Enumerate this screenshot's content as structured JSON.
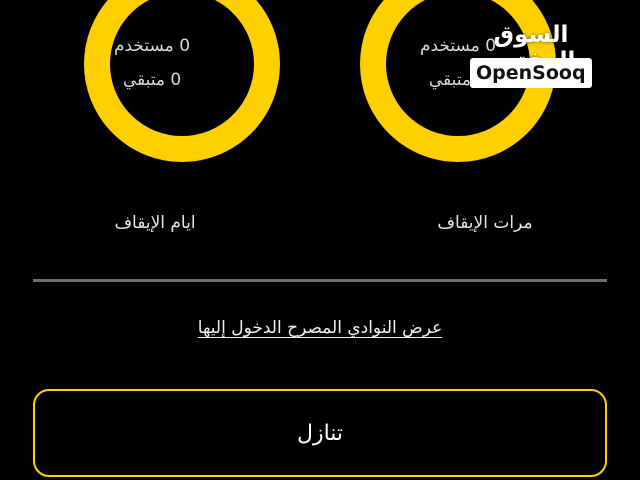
{
  "colors": {
    "accent": "#ffd000",
    "background": "#000000",
    "divider": "#6e6e6e"
  },
  "pause_days": {
    "used": "0 مستخدم",
    "remaining": "0 متبقي",
    "label": "ايام الإيقاف"
  },
  "pause_times": {
    "used": "0 مستخدم",
    "remaining": "0 متبقي",
    "label": "مرات الإيقاف"
  },
  "clubs_link": "عرض النوادي المصرح الدخول إليها",
  "waive_button": "تنازل",
  "watermark": {
    "arabic": "السوق المفتوح",
    "latin": "OpenSooq"
  }
}
